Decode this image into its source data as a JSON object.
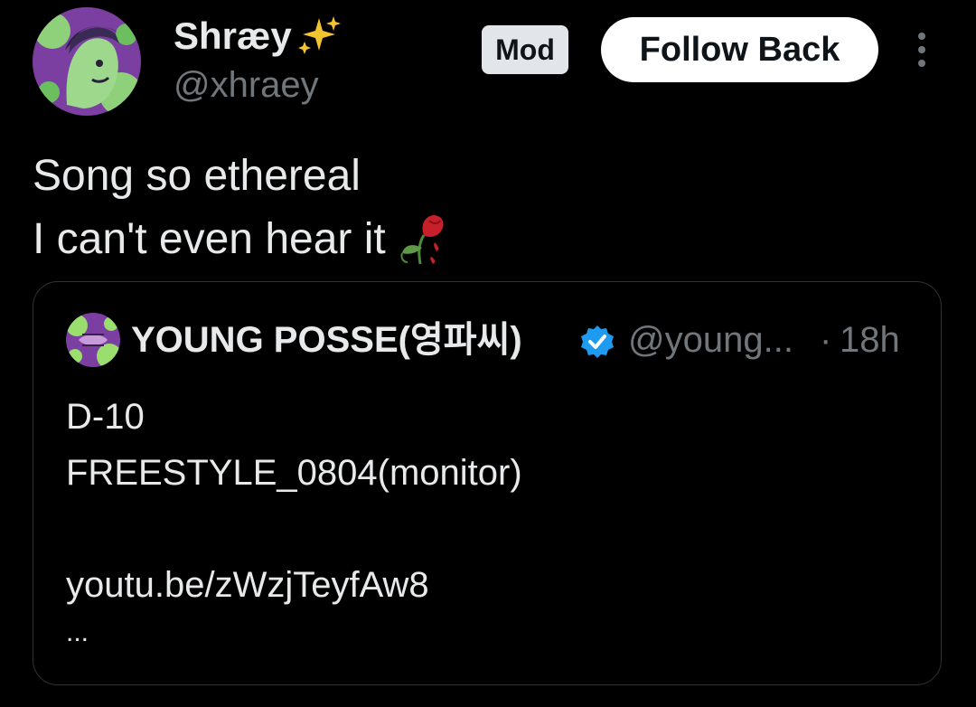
{
  "author": {
    "display_name": "Shræy",
    "handle": "@xhraey",
    "avatar_icon": "avatar-image",
    "name_emoji_icon": "sparkles-icon"
  },
  "badge": {
    "label": "Mod"
  },
  "follow_button": {
    "label": "Follow Back"
  },
  "more_menu": {
    "icon": "more-vertical-icon"
  },
  "tweet": {
    "lines": [
      "Song so ethereal",
      "I can't even hear it"
    ],
    "trailing_emoji_icon": "wilted-rose-icon"
  },
  "quote": {
    "author_name": "YOUNG POSSE(영파씨)",
    "verified_icon": "verified-badge-icon",
    "handle": "@young...",
    "separator": "·",
    "time": "18h",
    "lines": [
      "D-10",
      "FREESTYLE_0804(monitor)",
      "",
      "youtu.be/zWzjTeyfAw8"
    ],
    "ellipsis": "..."
  },
  "colors": {
    "background": "#000000",
    "primary_text": "#e7e9ea",
    "secondary_text": "#71767b",
    "border": "#2f3336",
    "verified": "#1d9bf0",
    "badge_bg": "#e2e6ea",
    "button_bg": "#ffffff"
  }
}
